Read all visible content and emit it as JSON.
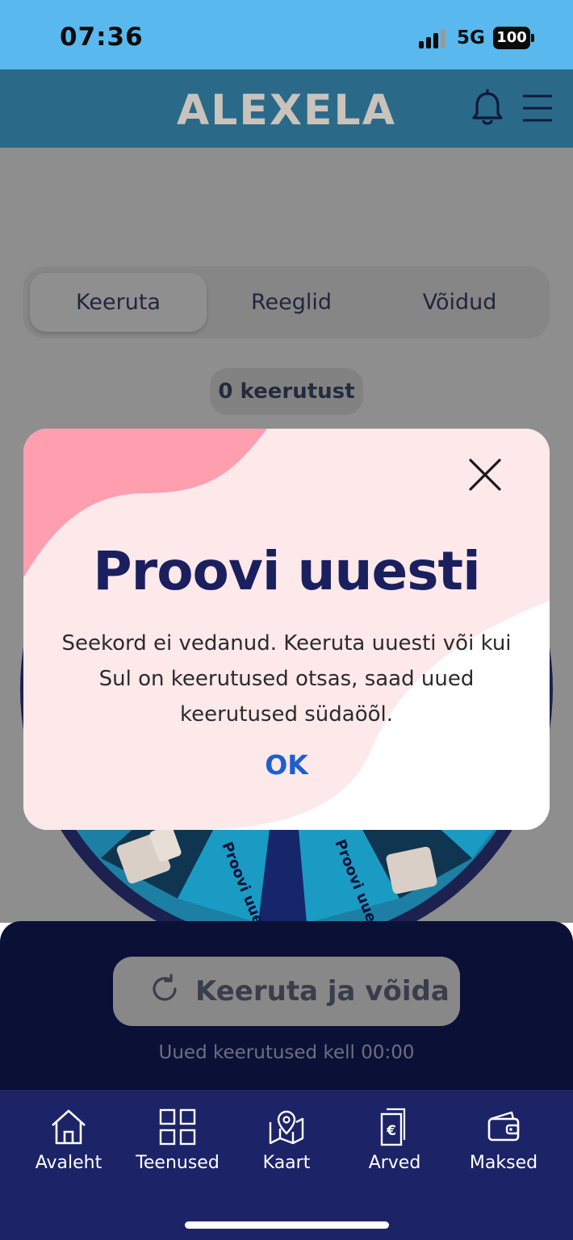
{
  "status_bar": {
    "time": "07:36",
    "network": "5G",
    "battery": "100"
  },
  "header": {
    "brand": "ALEXELA",
    "icons": [
      "bell-icon",
      "menu-icon"
    ]
  },
  "segment_tabs": [
    {
      "label": "Keeruta",
      "selected": true
    },
    {
      "label": "Reeglid",
      "selected": false
    },
    {
      "label": "Võidud",
      "selected": false
    }
  ],
  "spins_badge": "0 keerutust",
  "wheel": {
    "segment_text": "Proovi uuesti"
  },
  "spin_button": {
    "label": "Keeruta ja võida",
    "icon": "refresh-icon"
  },
  "next_spins": "Uued keerutused kell 00:00",
  "modal": {
    "title": "Proovi uuesti",
    "message": "Seekord ei vedanud. Keeruta uuesti või kui Sul on keerutused otsas, saad uued keerutused südaöõl.",
    "ok_label": "OK",
    "colors": {
      "pink": "#ff9eae",
      "light_pink": "#fde8ea",
      "title": "#1a1f5e",
      "ok": "#1f5fcc"
    }
  },
  "tab_bar": {
    "items": [
      {
        "label": "Avaleht",
        "icon": "home-icon"
      },
      {
        "label": "Teenused",
        "icon": "grid-icon"
      },
      {
        "label": "Kaart",
        "icon": "map-icon"
      },
      {
        "label": "Arved",
        "icon": "invoice-icon"
      },
      {
        "label": "Maksed",
        "icon": "wallet-icon"
      }
    ]
  },
  "colors": {
    "status_bar": "#59b9ee",
    "header": "#2a6a88",
    "bottom_panel": "#0b1036",
    "tab_bar": "#1c2467"
  }
}
